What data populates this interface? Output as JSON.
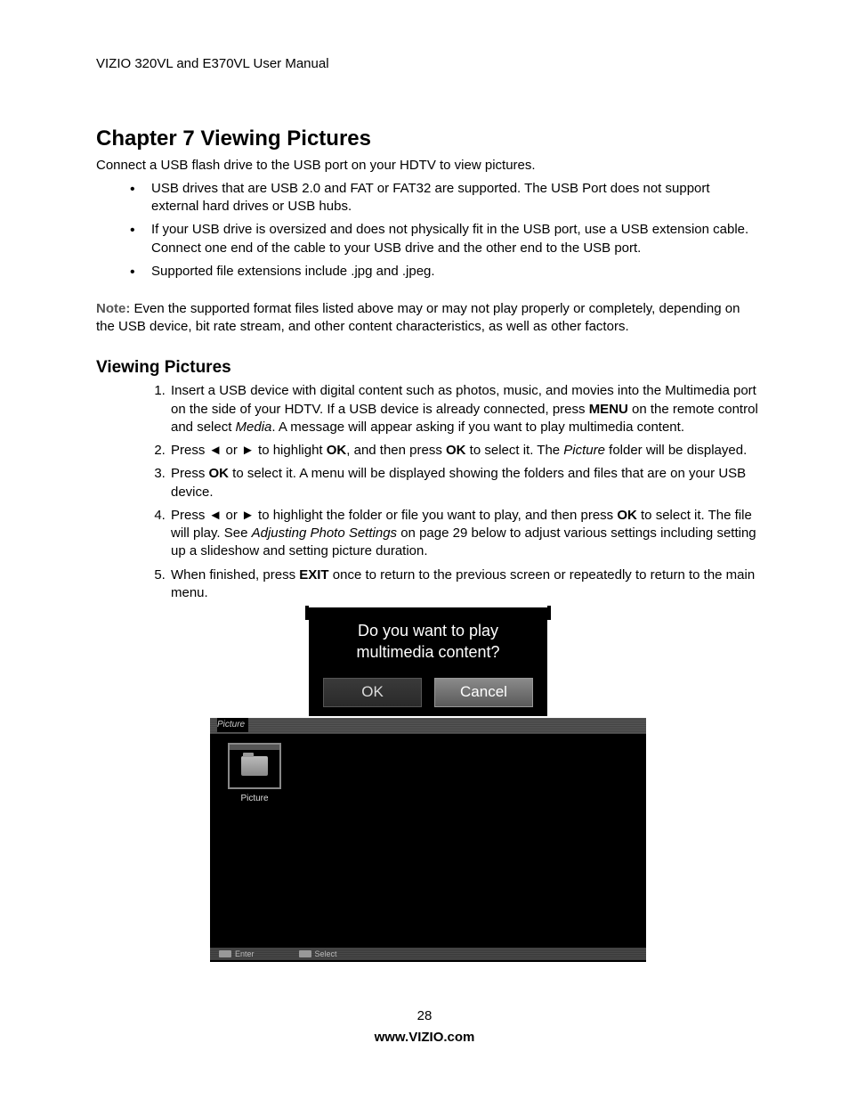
{
  "header": "VIZIO 320VL and E370VL User Manual",
  "h1": "Chapter 7 Viewing Pictures",
  "intro": "Connect a USB flash drive to the USB port on your HDTV to view pictures.",
  "bullets": [
    "USB drives that are USB 2.0 and FAT or FAT32 are supported. The USB Port does not support external hard drives or USB hubs.",
    "If your USB drive is oversized and does not physically fit in the USB port, use a USB extension cable. Connect one end of the cable to your USB drive and the other end to the USB port.",
    "Supported file extensions include .jpg and .jpeg."
  ],
  "note_label": "Note:",
  "note_body": " Even the supported format files listed above may or may not play properly or completely, depending on the USB device, bit rate stream, and other content characteristics, as well as other factors.",
  "h2": "Viewing Pictures",
  "steps": {
    "s1a": "Insert a USB device with digital content such as photos, music, and movies into the Multimedia port on the side of your HDTV. If a USB device is already connected, press ",
    "s1b_bold": "MENU",
    "s1c": " on the remote control and select ",
    "s1d_ital": "Media",
    "s1e": ". A message will appear asking if you want to play multimedia content.",
    "s2a": "Press ◄ or ► to highlight ",
    "s2b_bold": "OK",
    "s2c": ", and then press ",
    "s2d_bold": "OK",
    "s2e": " to select it. The ",
    "s2f_ital": "Picture",
    "s2g": " folder will be displayed.",
    "s3a": "Press ",
    "s3b_bold": "OK",
    "s3c": " to select it. A menu will be displayed showing the folders and files that are on your USB device.",
    "s4a": "Press ◄ or ► to highlight the folder or file you want to play, and then press ",
    "s4b_bold": "OK",
    "s4c": " to select it. The file will play. See ",
    "s4d_ital": "Adjusting Photo Settings",
    "s4e": " on page 29 below to adjust various settings including setting up a slideshow and setting picture duration.",
    "s5a": "When finished, press ",
    "s5b_bold": "EXIT",
    "s5c": " once to return to the previous screen or repeatedly to return to the main menu."
  },
  "dialog": {
    "line1": "Do you want to play",
    "line2": "multimedia content?",
    "ok": "OK",
    "cancel": "Cancel"
  },
  "browser": {
    "title": "Picture",
    "folder": "Picture",
    "hint_enter": "Enter",
    "hint_select": "Select"
  },
  "footer": {
    "page": "28",
    "url": "www.VIZIO.com"
  }
}
